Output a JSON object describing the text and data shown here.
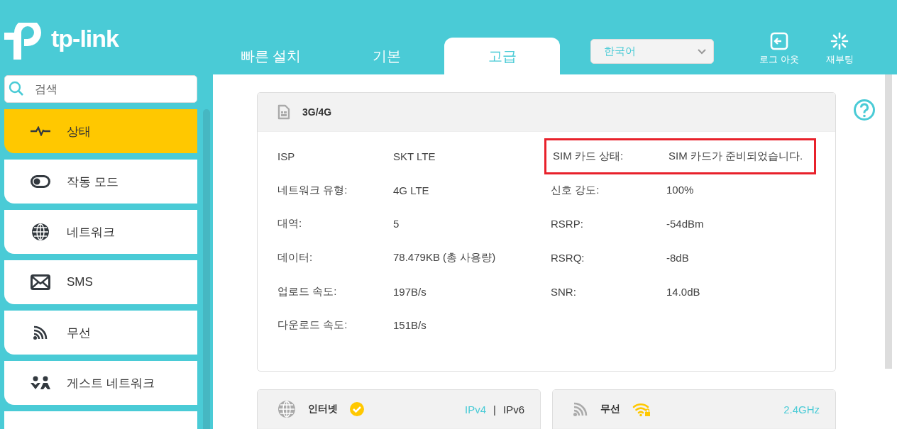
{
  "logo": {
    "text": "tp-link"
  },
  "tabs": [
    {
      "label": "빠른 설치",
      "selected": false
    },
    {
      "label": "기본",
      "selected": false
    },
    {
      "label": "고급",
      "selected": true
    }
  ],
  "language_select": {
    "value": "한국어"
  },
  "header_actions": [
    {
      "label": "로그 아웃",
      "kind": "logout"
    },
    {
      "label": "재부팅",
      "kind": "reboot"
    }
  ],
  "search": {
    "placeholder": "검색"
  },
  "sidebar": {
    "items": [
      {
        "label": "상태",
        "kind": "pulse",
        "selected": true
      },
      {
        "label": "작동 모드",
        "kind": "toggle",
        "selected": false
      },
      {
        "label": "네트워크",
        "kind": "globe",
        "selected": false
      },
      {
        "label": "SMS",
        "kind": "envelope",
        "selected": false
      },
      {
        "label": "무선",
        "kind": "signal",
        "selected": false
      },
      {
        "label": "게스트 네트워크",
        "kind": "guests",
        "selected": false
      }
    ]
  },
  "status_card": {
    "title": "3G/4G",
    "kind": "sim",
    "left": [
      {
        "label": "ISP",
        "value": "SKT LTE"
      },
      {
        "label": "네트워크 유형:",
        "value": "4G LTE"
      },
      {
        "label": "대역:",
        "value": "5"
      },
      {
        "label": "데이터:",
        "value": "78.479KB (총 사용량)"
      },
      {
        "label": "업로드 속도:",
        "value": "197B/s"
      },
      {
        "label": "다운로드 속도:",
        "value": "151B/s"
      }
    ],
    "right": [
      {
        "label": "SIM 카드 상태:",
        "value": "SIM 카드가 준비되었습니다.",
        "highlighted": true
      },
      {
        "label": "신호 강도:",
        "value": "100%",
        "highlighted": false
      },
      {
        "label": "RSRP:",
        "value": "-54dBm",
        "highlighted": false
      },
      {
        "label": "RSRQ:",
        "value": "-8dB",
        "highlighted": false
      },
      {
        "label": "SNR:",
        "value": "14.0dB",
        "highlighted": false
      }
    ]
  },
  "summary_cards": [
    {
      "title": "인터넷",
      "kind": "internet",
      "separator": "|",
      "links": [
        {
          "label": "IPv4",
          "selected": false
        },
        {
          "label": "IPv6",
          "selected": true
        }
      ]
    },
    {
      "title": "무선",
      "kind": "wireless",
      "links": [
        {
          "label": "2.4GHz",
          "selected": false
        }
      ]
    }
  ]
}
